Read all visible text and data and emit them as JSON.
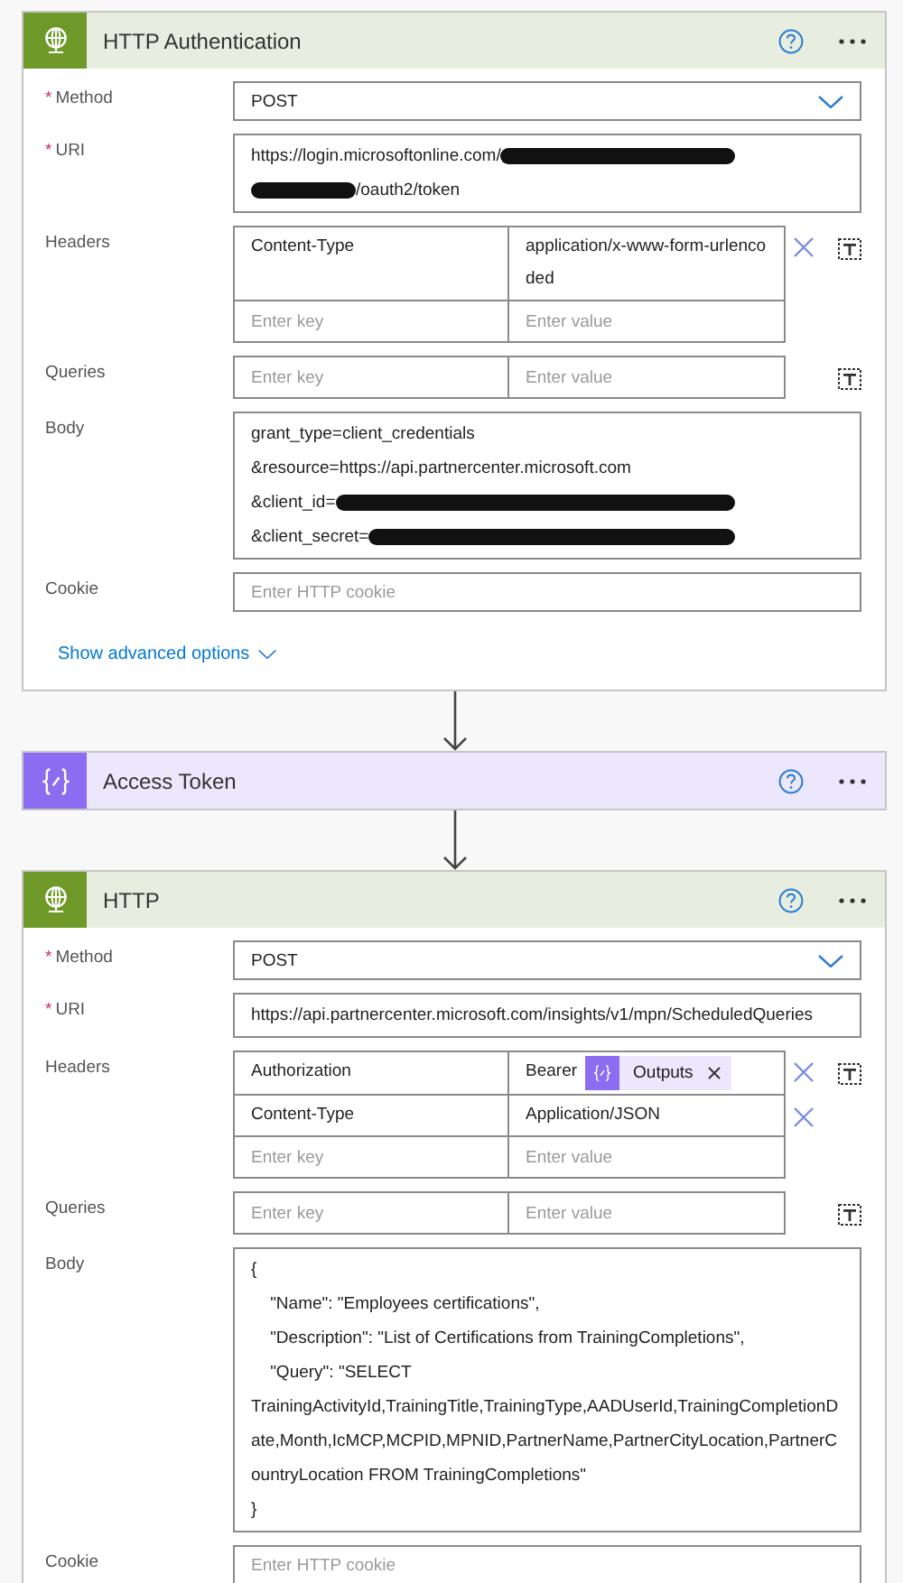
{
  "cards": [
    {
      "kind": "http",
      "title": "HTTP Authentication",
      "fields": [
        {
          "kind": "dropdown",
          "label": "Method",
          "asterisk": "*",
          "value": "POST"
        },
        {
          "kind": "lines",
          "label": "URI",
          "asterisk": "*",
          "lines": [
            [
              {
                "kind": "text",
                "text": "https://login.microsoftonline.com/"
              },
              {
                "kind": "redacted"
              }
            ],
            [
              {
                "kind": "redacted"
              },
              {
                "kind": "text",
                "text": "/oauth2/token"
              }
            ]
          ]
        },
        {
          "kind": "keyvalue",
          "label": "Headers",
          "rows": [
            {
              "key": "Content-Type",
              "value": [
                {
                  "kind": "text",
                  "text": "application/x-www-form-urlencoded"
                }
              ]
            }
          ],
          "key_placeholder": "Enter key",
          "value_placeholder": "Enter value"
        },
        {
          "kind": "keyvalue",
          "label": "Queries",
          "key_placeholder": "Enter key",
          "value_placeholder": "Enter value"
        },
        {
          "kind": "lines",
          "label": "Body",
          "lines": [
            [
              {
                "kind": "text",
                "text": "grant_type=client_credentials"
              }
            ],
            [
              {
                "kind": "text",
                "text": "&resource=https://api.partnercenter.microsoft.com"
              }
            ],
            [
              {
                "kind": "text",
                "text": "&client_id="
              },
              {
                "kind": "redacted"
              }
            ],
            [
              {
                "kind": "text",
                "text": "&client_secret="
              },
              {
                "kind": "redacted"
              }
            ]
          ]
        },
        {
          "kind": "input",
          "label": "Cookie",
          "placeholder": "Enter HTTP cookie"
        }
      ],
      "link": "Show advanced options"
    },
    {
      "kind": "variable",
      "title": "Access Token"
    },
    {
      "kind": "http",
      "title": "HTTP",
      "fields": [
        {
          "kind": "dropdown",
          "label": "Method",
          "asterisk": "*",
          "value": "POST"
        },
        {
          "kind": "lines",
          "label": "URI",
          "asterisk": "*",
          "lines": [
            [
              {
                "kind": "text",
                "text": "https://api.partnercenter.microsoft.com/insights/v1/mpn/ScheduledQueries"
              }
            ]
          ]
        },
        {
          "kind": "keyvalue",
          "label": "Headers",
          "rows": [
            {
              "key": "Authorization",
              "value": [
                {
                  "kind": "text",
                  "text": "Bearer"
                },
                {
                  "kind": "token",
                  "text": "Outputs"
                }
              ]
            },
            {
              "key": "Content-Type",
              "value": [
                {
                  "kind": "text",
                  "text": "Application/JSON"
                }
              ]
            }
          ],
          "key_placeholder": "Enter key",
          "value_placeholder": "Enter value"
        },
        {
          "kind": "keyvalue",
          "label": "Queries",
          "key_placeholder": "Enter key",
          "value_placeholder": "Enter value"
        },
        {
          "kind": "lines",
          "label": "Body",
          "lines": [
            [
              {
                "kind": "text",
                "text": "{"
              }
            ],
            [
              {
                "kind": "text",
                "text": "    \"Name\": \"Employees certifications\","
              }
            ],
            [
              {
                "kind": "text",
                "text": "    \"Description\": \"List of Certifications from TrainingCompletions\","
              }
            ],
            [
              {
                "kind": "text",
                "text": "    \"Query\": \"SELECT"
              }
            ],
            [
              {
                "kind": "text",
                "text": "TrainingActivityId,TrainingTitle,TrainingType,AADUserId,TrainingCompletionDate,Month,IcMCP,MCPID,MPNID,PartnerName,PartnerCityLocation,PartnerCountryLocation FROM TrainingCompletions\""
              }
            ],
            [
              {
                "kind": "text",
                "text": "}"
              }
            ]
          ]
        },
        {
          "kind": "input",
          "label": "Cookie",
          "placeholder": "Enter HTTP cookie"
        }
      ]
    }
  ]
}
